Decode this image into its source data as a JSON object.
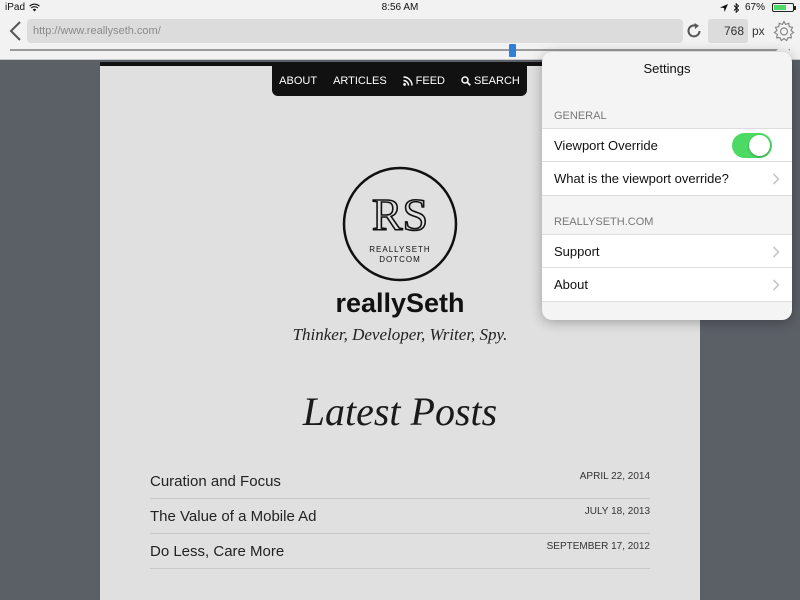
{
  "status_bar": {
    "device": "iPad",
    "time": "8:56 AM",
    "battery_percent": "67%",
    "battery_level": 0.67
  },
  "toolbar": {
    "url": "http://www.reallyseth.com/",
    "viewport_width": "768",
    "unit_label": "px",
    "slider_level": 0.64
  },
  "site": {
    "nav": {
      "about": "ABOUT",
      "articles": "ARTICLES",
      "feed": "FEED",
      "search": "SEARCH"
    },
    "logo": {
      "monogram": "RS",
      "line1": "REALLYSETH",
      "line2": "DOTCOM"
    },
    "title": "reallySeth",
    "tagline": "Thinker, Developer, Writer, Spy.",
    "section_title": "Latest Posts",
    "posts": [
      {
        "title": "Curation and Focus",
        "date": "APRIL 22, 2014"
      },
      {
        "title": "The Value of a Mobile Ad",
        "date": "JULY 18, 2013"
      },
      {
        "title": "Do Less, Care More",
        "date": "SEPTEMBER 17, 2012"
      }
    ]
  },
  "settings": {
    "title": "Settings",
    "general_header": "GENERAL",
    "viewport_override_label": "Viewport Override",
    "viewport_override_on": true,
    "what_is_label": "What is the viewport override?",
    "site_header": "REALLYSETH.COM",
    "support_label": "Support",
    "about_label": "About"
  },
  "colors": {
    "accent": "#2f7ed8",
    "toggle_on": "#4cd964",
    "background": "#5b5f66"
  }
}
